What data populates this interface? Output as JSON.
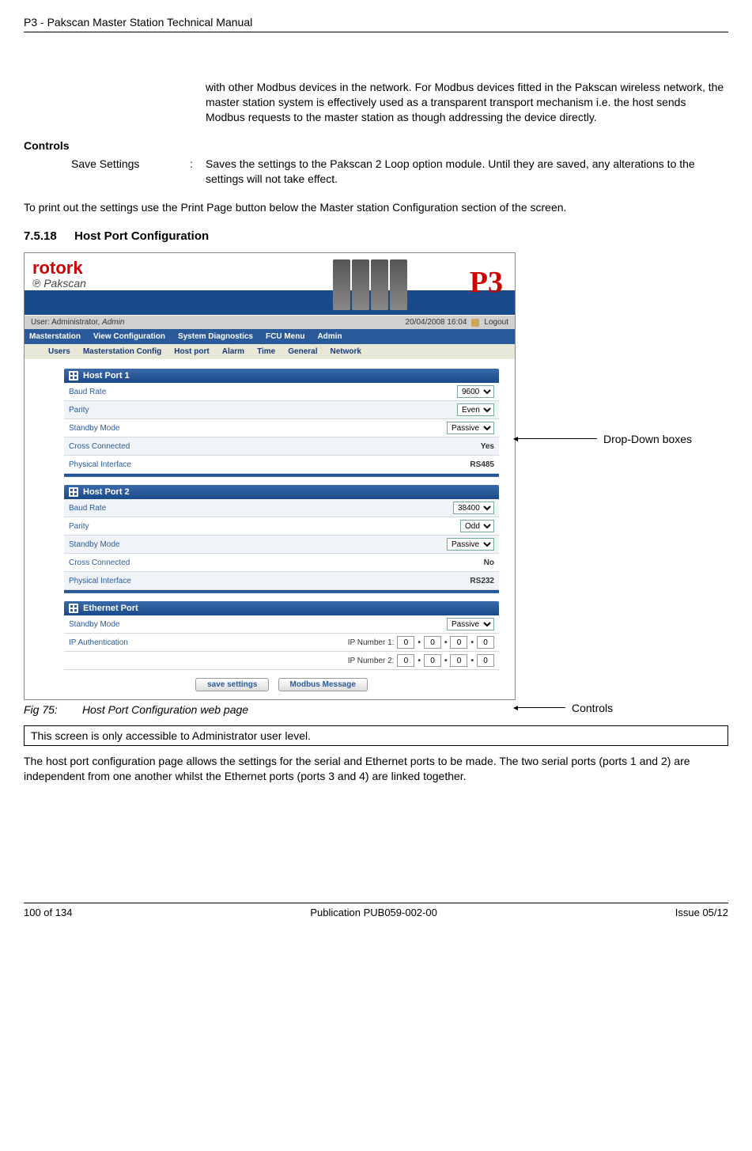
{
  "header": {
    "title": "P3 - Pakscan Master Station Technical Manual"
  },
  "intro_para": "with other Modbus devices in the network.  For Modbus devices fitted in the Pakscan wireless network, the master station system is effectively used as a transparent transport mechanism i.e. the host sends Modbus requests to the master station as though addressing the device directly.",
  "controls_label": "Controls",
  "save_settings": {
    "label": "Save Settings",
    "sep": ":",
    "text": "Saves the settings to the Pakscan 2 Loop option module. Until they are saved, any alterations to the settings will not take effect."
  },
  "print_text": "To print out the settings use the Print Page button below the Master station Configuration section of the screen.",
  "section": {
    "num": "7.5.18",
    "title": "Host Port Configuration"
  },
  "screenshot": {
    "logo_main": "rotork",
    "logo_sub": "Pakscan",
    "p3": "P3",
    "user_left": "User: Administrator, Admin",
    "datetime": "20/04/2008 16:04",
    "logout": "Logout",
    "menu1": [
      "Masterstation",
      "View Configuration",
      "System Diagnostics",
      "FCU Menu",
      "Admin"
    ],
    "menu2": [
      "Users",
      "Masterstation Config",
      "Host port",
      "Alarm",
      "Time",
      "General",
      "Network"
    ],
    "panel1": {
      "title": "Host Port 1",
      "baud_label": "Baud Rate",
      "baud_value": "9600",
      "parity_label": "Parity",
      "parity_value": "Even",
      "standby_label": "Standby Mode",
      "standby_value": "Passive",
      "cross_label": "Cross Connected",
      "cross_value": "Yes",
      "phys_label": "Physical Interface",
      "phys_value": "RS485"
    },
    "panel2": {
      "title": "Host Port 2",
      "baud_label": "Baud Rate",
      "baud_value": "38400",
      "parity_label": "Parity",
      "parity_value": "Odd",
      "standby_label": "Standby Mode",
      "standby_value": "Passive",
      "cross_label": "Cross Connected",
      "cross_value": "No",
      "phys_label": "Physical Interface",
      "phys_value": "RS232"
    },
    "panel3": {
      "title": "Ethernet Port",
      "standby_label": "Standby Mode",
      "standby_value": "Passive",
      "ipauth_label": "IP Authentication",
      "ip1_label": "IP Number 1:",
      "ip2_label": "IP Number 2:",
      "ip_vals": [
        "0",
        "0",
        "0",
        "0"
      ]
    },
    "btn_save": "save settings",
    "btn_modbus": "Modbus Message"
  },
  "annotations": {
    "dropdown": "Drop-Down boxes",
    "controls": "Controls"
  },
  "figure": {
    "num": "Fig 75:",
    "caption": "Host Port Configuration web page"
  },
  "note": "This screen is only accessible to Administrator user level.",
  "closing": "The host port configuration page allows the settings for the serial and Ethernet ports to be made. The two serial ports (ports 1 and 2) are independent from one another whilst the Ethernet ports (ports 3 and 4) are linked together.",
  "footer": {
    "left": "100 of 134",
    "center": "Publication PUB059-002-00",
    "right": "Issue 05/12"
  }
}
